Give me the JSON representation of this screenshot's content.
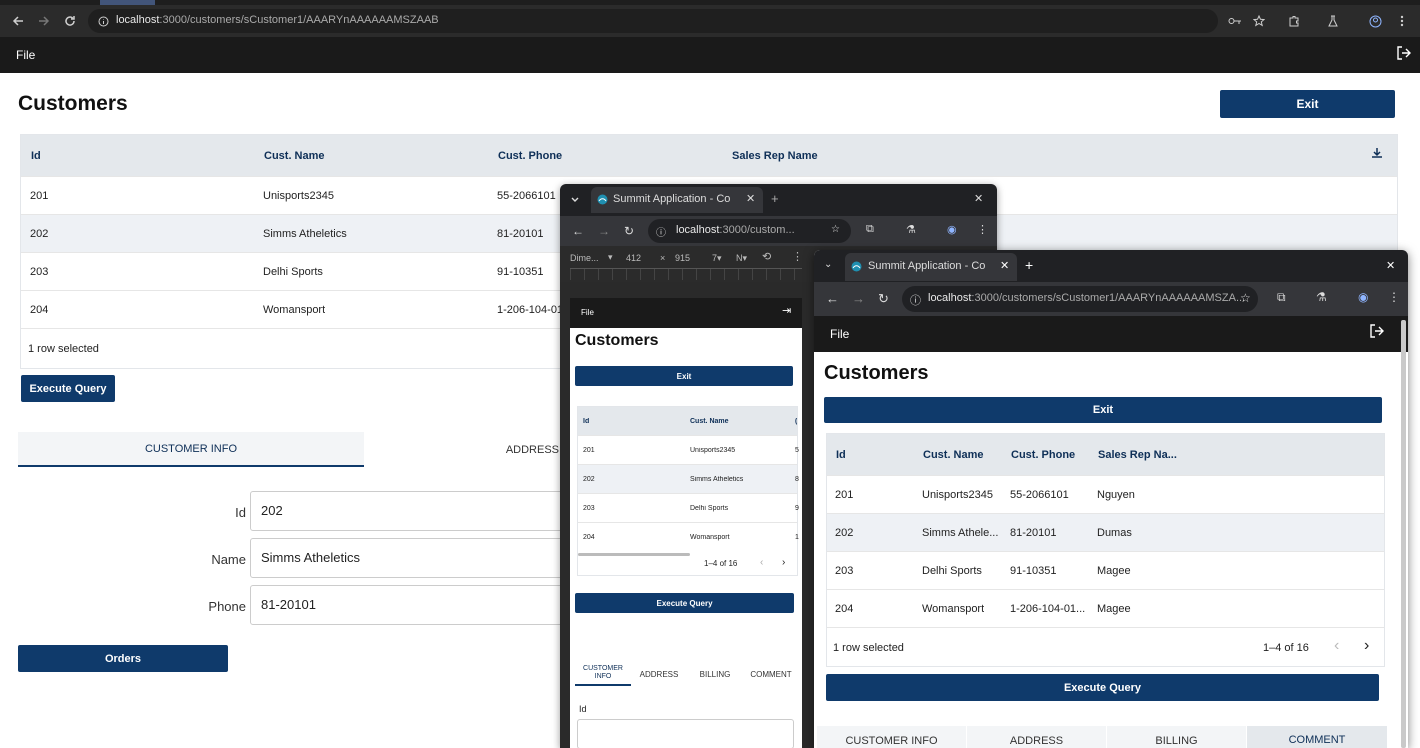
{
  "browser": {
    "url_host": "localhost",
    "url_path": ":3000/customers/sCustomer1/AAARYnAAAAAAMSZAAB"
  },
  "app": {
    "menu_file": "File",
    "page_title": "Customers",
    "exit_label": "Exit",
    "execute_label": "Execute Query",
    "orders_label": "Orders",
    "grid": {
      "headers": [
        "Id",
        "Cust. Name",
        "Cust. Phone",
        "Sales Rep Name"
      ],
      "rows": [
        [
          "201",
          "Unisports2345",
          "55-2066101",
          ""
        ],
        [
          "202",
          "Simms Atheletics",
          "81-20101",
          ""
        ],
        [
          "203",
          "Delhi Sports",
          "91-10351",
          ""
        ],
        [
          "204",
          "Womansport",
          "1-206-104-01",
          ""
        ]
      ],
      "footer": "1 row selected"
    },
    "tabs": [
      "CUSTOMER INFO",
      "ADDRESS"
    ],
    "form": {
      "id_label": "Id",
      "id_value": "202",
      "name_label": "Name",
      "name_value": "Simms Atheletics",
      "phone_label": "Phone",
      "phone_value": "81-20101"
    }
  },
  "win1": {
    "tab_title": "Summit Application - Co",
    "url_host": "localhost",
    "url_path": ":3000/custom...",
    "device": {
      "name": "Dime...",
      "width": "412",
      "x": "×",
      "height": "915",
      "zoom": "7▾",
      "throttle": "N▾"
    },
    "menu_file": "File",
    "title": "Customers",
    "exit_label": "Exit",
    "headers": [
      "Id",
      "Cust. Name",
      "("
    ],
    "rows": [
      [
        "201",
        "Unisports2345",
        "5"
      ],
      [
        "202",
        "Simms Atheletics",
        "8"
      ],
      [
        "203",
        "Delhi Sports",
        "9"
      ],
      [
        "204",
        "Womansport",
        "1"
      ]
    ],
    "pager": "1–4 of 16",
    "execute_label": "Execute Query",
    "tabs": [
      "CUSTOMER INFO",
      "ADDRESS",
      "BILLING",
      "COMMENT"
    ],
    "id_label": "Id"
  },
  "win2": {
    "tab_title": "Summit Application - Co",
    "url_host": "localhost",
    "url_path": ":3000/customers/sCustomer1/AAARYnAAAAAAMSZA...",
    "menu_file": "File",
    "title": "Customers",
    "exit_label": "Exit",
    "headers": [
      "Id",
      "Cust. Name",
      "Cust. Phone",
      "Sales Rep Na..."
    ],
    "rows": [
      [
        "201",
        "Unisports2345",
        "55-2066101",
        "Nguyen"
      ],
      [
        "202",
        "Simms Athele...",
        "81-20101",
        "Dumas"
      ],
      [
        "203",
        "Delhi Sports",
        "91-10351",
        "Magee"
      ],
      [
        "204",
        "Womansport",
        "1-206-104-01...",
        "Magee"
      ]
    ],
    "footer": "1 row selected",
    "pager": "1–4 of 16",
    "execute_label": "Execute Query",
    "tabs": [
      "CUSTOMER INFO",
      "ADDRESS",
      "BILLING",
      "COMMENT"
    ]
  },
  "colors": {
    "primary": "#0f3a6b",
    "header_bg": "#e4e8ec",
    "appbar": "#1a1a1a",
    "selected_row": "#eef1f5"
  }
}
